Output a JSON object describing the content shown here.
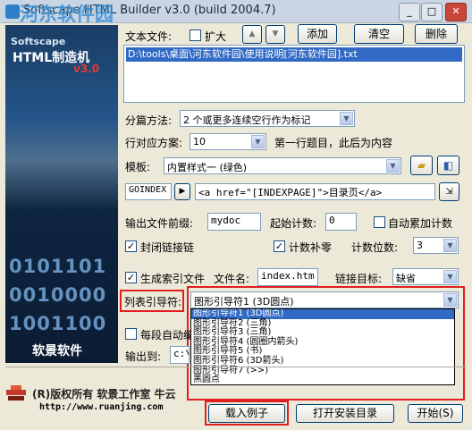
{
  "window": {
    "title": "Softscape HTML Builder v3.0 (build 2004.7)",
    "watermark": "河东软件园",
    "watermark_url": "pc0359",
    "min": "_",
    "max": "□",
    "close": "✕"
  },
  "banner": {
    "logo_top": "Softscape",
    "logo_main": "HTML制造机",
    "version": "v3.0",
    "binary": [
      "0101101",
      "0010000",
      "1001100"
    ],
    "brand": "软景软件"
  },
  "file": {
    "label": "文本文件:",
    "expand_label": "扩大",
    "up": "▲",
    "down": "▼",
    "add": "添加",
    "clear": "清空",
    "delete": "删除",
    "path": "D:\\tools\\桌面\\河东软件园\\使用说明[河东软件园].txt"
  },
  "split": {
    "label": "分篇方法:",
    "value": "2 个或更多连续空行作为标记"
  },
  "lines": {
    "label": "行对应方案:",
    "value": "10",
    "note": "第一行题目，此后为内容"
  },
  "template": {
    "label": "模板:",
    "value": "内置样式一 (绿色)"
  },
  "goindex": {
    "tag": "GOINDEX",
    "value": "<a href=\"[INDEXPAGE]\">目录页</a>"
  },
  "output": {
    "prefix_label": "输出文件前缀:",
    "prefix": "mydoc",
    "start_label": "起始计数:",
    "start": "0",
    "auto_label": "自动累加计数"
  },
  "flags": {
    "close_chain": "封闭链接链",
    "pad_label": "计数补零",
    "digits_label": "计数位数:",
    "digits": "3"
  },
  "index": {
    "gen_label": "生成索引文件",
    "filename_label": "文件名:",
    "filename": "index.htm",
    "target_label": "链接目标:",
    "target": "缺省"
  },
  "list_guide": {
    "label": "列表引导符:",
    "value": "图形引导符1 (3D圆点)",
    "options": [
      "图形引导符1 (3D圆点)",
      "图形引导符2 (三角)",
      "图形引导符3 (三角)",
      "图形引导符4 (圆圈内箭头)",
      "图形引导符5 (书)",
      "图形引导符6 (3D箭头)",
      "图形引导符7 (>>)",
      "黑圆点"
    ]
  },
  "misc": {
    "auto_split": "每段自动编",
    "output_to_label": "输出到:",
    "output_to": "c:\\"
  },
  "footer": {
    "copyright": "(R)版权所有 软景工作室 牛云",
    "url": "http://www.ruanjing.com",
    "load_btn": "载入例子",
    "install_btn": "打开安装目录",
    "start_btn": "开始(S)"
  }
}
